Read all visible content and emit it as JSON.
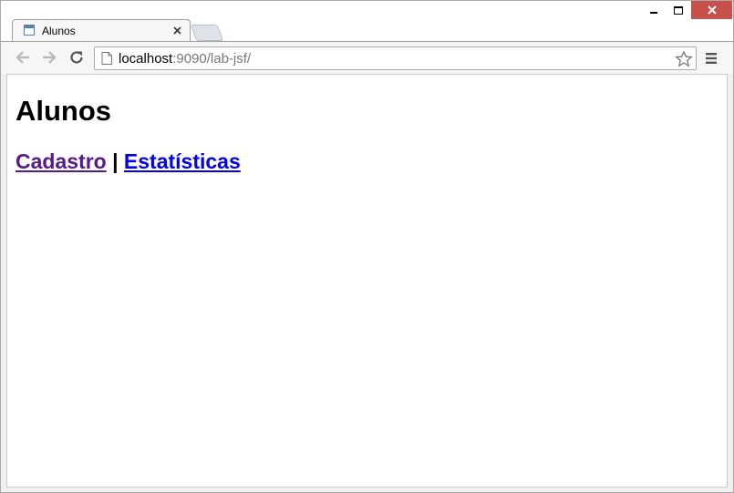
{
  "browser": {
    "tab": {
      "title": "Alunos",
      "favicon": "page-favicon-icon"
    },
    "url": {
      "host": "localhost",
      "rest": ":9090/lab-jsf/"
    },
    "window_controls": {
      "close_color": "#c7504a"
    }
  },
  "page": {
    "heading": "Alunos",
    "nav": {
      "links": [
        "Cadastro",
        "Estatísticas"
      ],
      "separator": "|"
    },
    "colors": {
      "visited_link": "#551a8b",
      "link": "#0000ee"
    }
  }
}
